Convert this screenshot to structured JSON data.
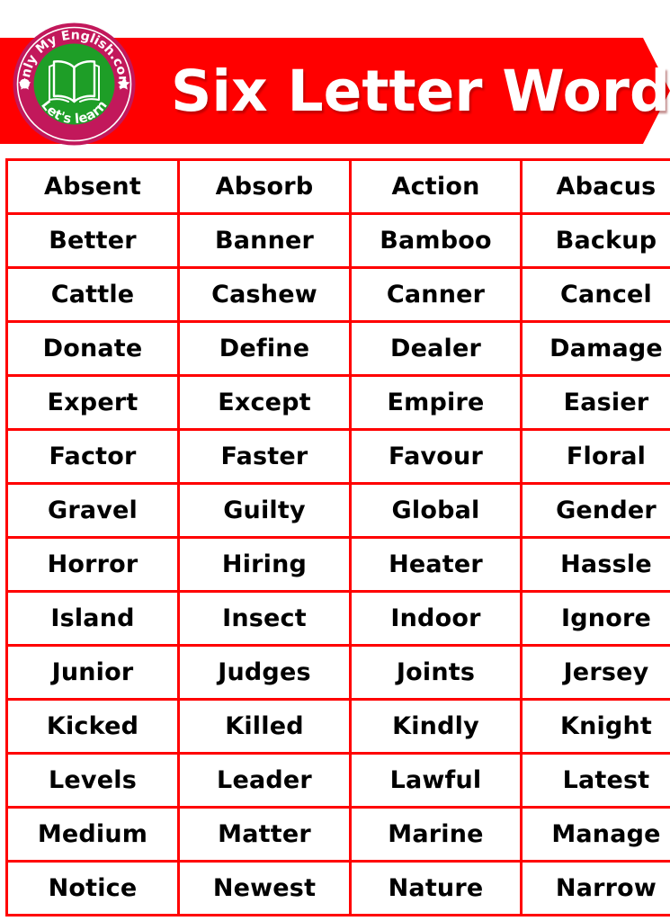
{
  "colors": {
    "banner": "#ff0000",
    "grid": "#ff0000",
    "logo_ring": "#c2185b",
    "logo_inner": "#1e9e27",
    "text": "#000000",
    "title_text": "#ffffff"
  },
  "header": {
    "title": "Six Letter Words",
    "logo": {
      "top_text": "Only My English.com",
      "bottom_text": "Let's learn",
      "icon": "open-book-icon"
    }
  },
  "table": {
    "columns": 4,
    "rows": [
      [
        "Absent",
        "Absorb",
        "Action",
        "Abacus"
      ],
      [
        "Better",
        "Banner",
        "Bamboo",
        "Backup"
      ],
      [
        "Cattle",
        "Cashew",
        "Canner",
        "Cancel"
      ],
      [
        "Donate",
        "Define",
        "Dealer",
        "Damage"
      ],
      [
        "Expert",
        "Except",
        "Empire",
        "Easier"
      ],
      [
        "Factor",
        "Faster",
        "Favour",
        "Floral"
      ],
      [
        "Gravel",
        "Guilty",
        "Global",
        "Gender"
      ],
      [
        "Horror",
        "Hiring",
        "Heater",
        "Hassle"
      ],
      [
        "Island",
        "Insect",
        "Indoor",
        "Ignore"
      ],
      [
        "Junior",
        "Judges",
        "Joints",
        "Jersey"
      ],
      [
        "Kicked",
        "Killed",
        "Kindly",
        "Knight"
      ],
      [
        "Levels",
        "Leader",
        "Lawful",
        "Latest"
      ],
      [
        "Medium",
        "Matter",
        "Marine",
        "Manage"
      ],
      [
        "Notice",
        "Newest",
        "Nature",
        "Narrow"
      ]
    ]
  }
}
